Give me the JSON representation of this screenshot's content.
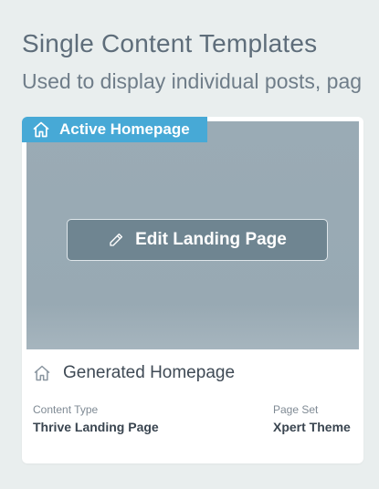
{
  "header": {
    "title": "Single Content Templates",
    "subtitle": "Used to display individual posts, pag"
  },
  "card": {
    "badge_label": "Active Homepage",
    "edit_button_label": "Edit Landing Page",
    "template_name": "Generated Homepage",
    "content_type_label": "Content Type",
    "content_type_value": "Thrive Landing Page",
    "page_set_label": "Page Set",
    "page_set_value": "Xpert Theme"
  },
  "colors": {
    "badge": "#47a9d6",
    "preview_bg": "#9aabb5",
    "edit_button_bg": "#6f8591",
    "page_bg": "#e9eeee"
  },
  "icons": {
    "badge_icon": "home-icon",
    "edit_icon": "pencil-icon",
    "template_icon": "home-icon"
  }
}
